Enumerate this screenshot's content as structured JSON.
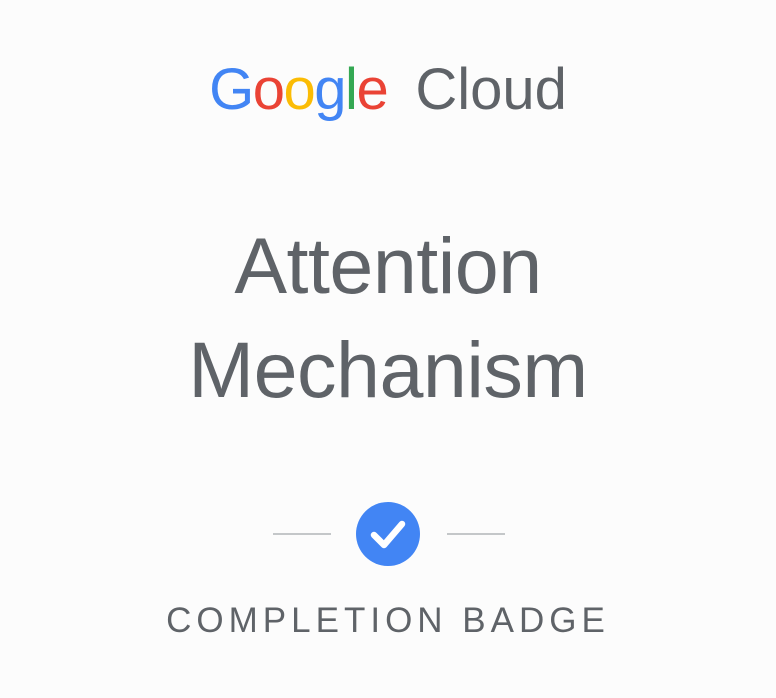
{
  "brand": {
    "google_letters": [
      {
        "char": "G",
        "color": "#4285F4"
      },
      {
        "char": "o",
        "color": "#EA4335"
      },
      {
        "char": "o",
        "color": "#FBBC05"
      },
      {
        "char": "g",
        "color": "#4285F4"
      },
      {
        "char": "l",
        "color": "#34A853"
      },
      {
        "char": "e",
        "color": "#EA4335"
      }
    ],
    "product": "Cloud",
    "text_color": "#5F6368"
  },
  "badge": {
    "title_line1": "Attention",
    "title_line2": "Mechanism",
    "check_icon": "checkmark-icon",
    "accent_color": "#4285F4",
    "caption": "COMPLETION BADGE"
  }
}
